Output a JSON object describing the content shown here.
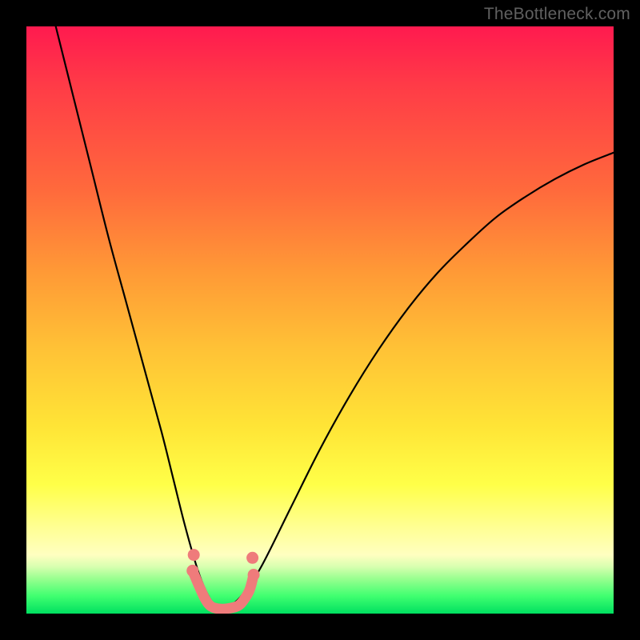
{
  "watermark": "TheBottleneck.com",
  "chart_data": {
    "type": "line",
    "title": "",
    "xlabel": "",
    "ylabel": "",
    "xlim": [
      0,
      100
    ],
    "ylim": [
      0,
      100
    ],
    "legend": false,
    "grid": false,
    "background_gradient": {
      "orientation": "vertical",
      "stops": [
        {
          "pos": 0.0,
          "color": "#ff1a4f"
        },
        {
          "pos": 0.1,
          "color": "#ff3b47"
        },
        {
          "pos": 0.28,
          "color": "#ff6a3c"
        },
        {
          "pos": 0.42,
          "color": "#ff9a36"
        },
        {
          "pos": 0.55,
          "color": "#ffc236"
        },
        {
          "pos": 0.68,
          "color": "#ffe436"
        },
        {
          "pos": 0.78,
          "color": "#ffff48"
        },
        {
          "pos": 0.85,
          "color": "#ffff90"
        },
        {
          "pos": 0.9,
          "color": "#ffffc0"
        },
        {
          "pos": 0.92,
          "color": "#d8ffb0"
        },
        {
          "pos": 0.94,
          "color": "#9aff90"
        },
        {
          "pos": 0.97,
          "color": "#40ff70"
        },
        {
          "pos": 1.0,
          "color": "#00e060"
        }
      ]
    },
    "series": [
      {
        "name": "black-curve",
        "color": "#000000",
        "width": 2,
        "x": [
          5,
          8,
          11,
          14,
          17,
          20,
          23,
          25,
          27,
          29,
          30.5,
          32,
          33.5,
          35,
          37,
          40,
          45,
          50,
          55,
          60,
          65,
          70,
          75,
          80,
          85,
          90,
          95,
          100
        ],
        "y": [
          100,
          88,
          76,
          64,
          53,
          42,
          31,
          23,
          15,
          8,
          4,
          1.5,
          0.8,
          1.5,
          3.5,
          8,
          18,
          28,
          37,
          45,
          52,
          58,
          63,
          67.5,
          71,
          74,
          76.5,
          78.5
        ]
      },
      {
        "name": "pink-bottom-accent",
        "color": "#ef7b7b",
        "width": 8,
        "x": [
          28.3,
          29.5,
          30.5,
          31.5,
          33,
          34.5,
          36,
          37,
          38,
          38.7
        ],
        "y": [
          7.3,
          4.5,
          2.4,
          1.2,
          0.8,
          0.9,
          1.3,
          2.3,
          4.0,
          6.6
        ]
      }
    ],
    "markers": [
      {
        "series": "pink-bottom-accent",
        "x": 28.3,
        "y": 7.3,
        "r": 4.5,
        "color": "#ef7b7b"
      },
      {
        "series": "pink-bottom-accent",
        "x": 28.5,
        "y": 10.0,
        "r": 4.5,
        "color": "#ef7b7b"
      },
      {
        "series": "pink-bottom-accent",
        "x": 38.7,
        "y": 6.6,
        "r": 4.5,
        "color": "#ef7b7b"
      },
      {
        "series": "pink-bottom-accent",
        "x": 38.5,
        "y": 9.5,
        "r": 4.5,
        "color": "#ef7b7b"
      }
    ]
  }
}
